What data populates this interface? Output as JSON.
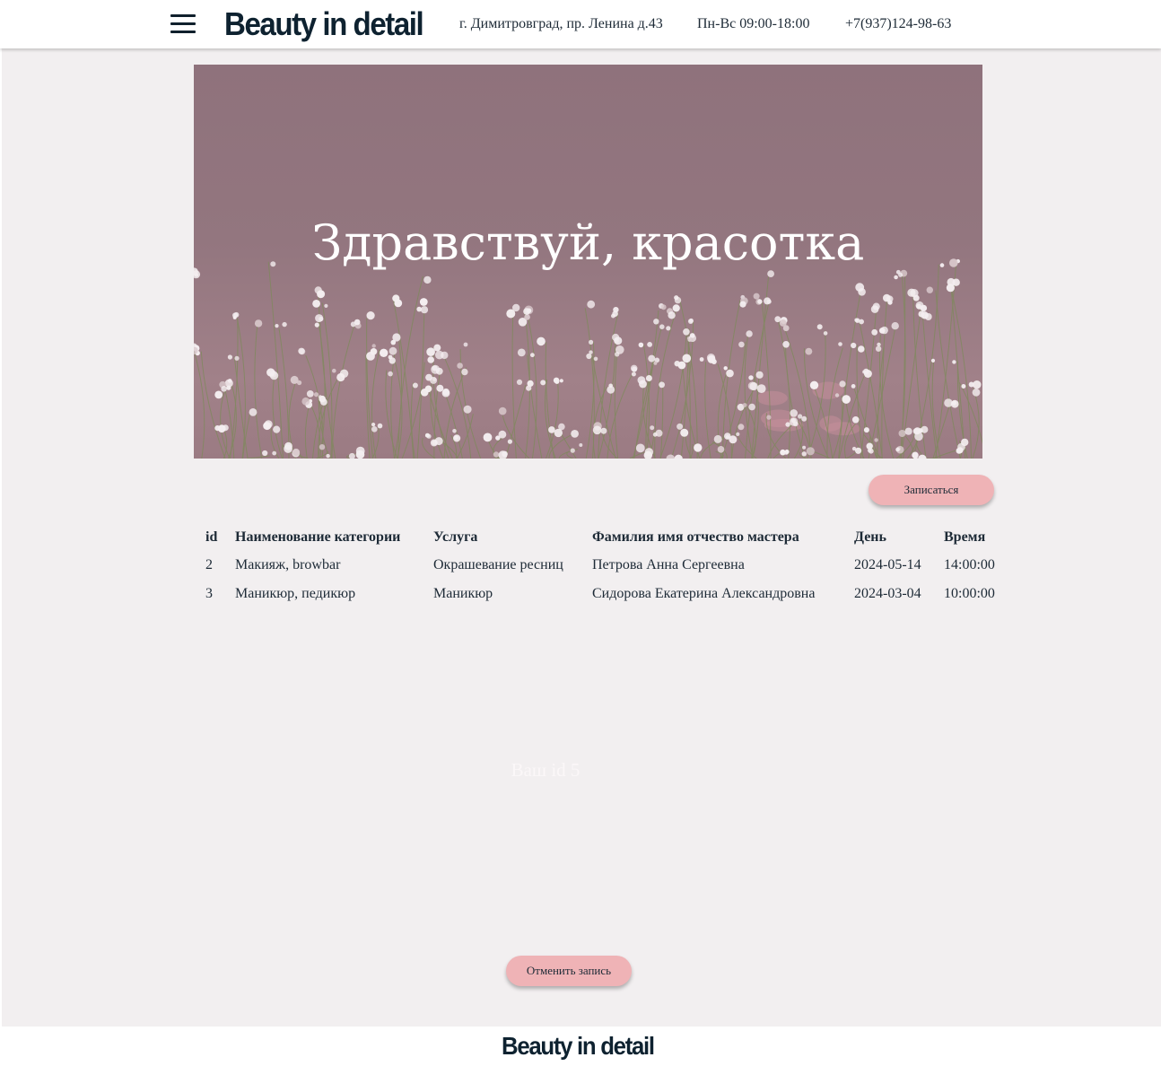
{
  "header": {
    "brand": "Beauty in detail",
    "address": "г. Димитровград, пр. Ленина д.43",
    "hours": "Пн-Вс 09:00-18:00",
    "phone": "+7(937)124-98-63"
  },
  "hero": {
    "title": "Здравствуй, красотка"
  },
  "actions": {
    "signup_label": "Записаться",
    "cancel_label": "Отменить запись"
  },
  "table": {
    "headers": [
      "id",
      "Наименование категории",
      "Услуга",
      "Фамилия имя отчество мастера",
      "День",
      "Время"
    ],
    "rows": [
      [
        "2",
        "Макияж, browbar",
        "Окрашевание ресниц",
        "Петрова Анна Сергеевна",
        "2024-05-14",
        "14:00:00"
      ],
      [
        "3",
        "Маникюр, педикюр",
        "Маникюр",
        "Сидорова Екатерина Александровна",
        "2024-03-04",
        "10:00:00"
      ]
    ]
  },
  "your_id": "Ваш id 5",
  "footer": {
    "brand": "Beauty in detail"
  },
  "colors": {
    "accent_button": "#efb3b6",
    "brand_text": "#0e2230",
    "page_background": "#f2eff0",
    "hero_tint": "#8f727c"
  },
  "icons": {
    "menu": "hamburger-menu-icon"
  }
}
